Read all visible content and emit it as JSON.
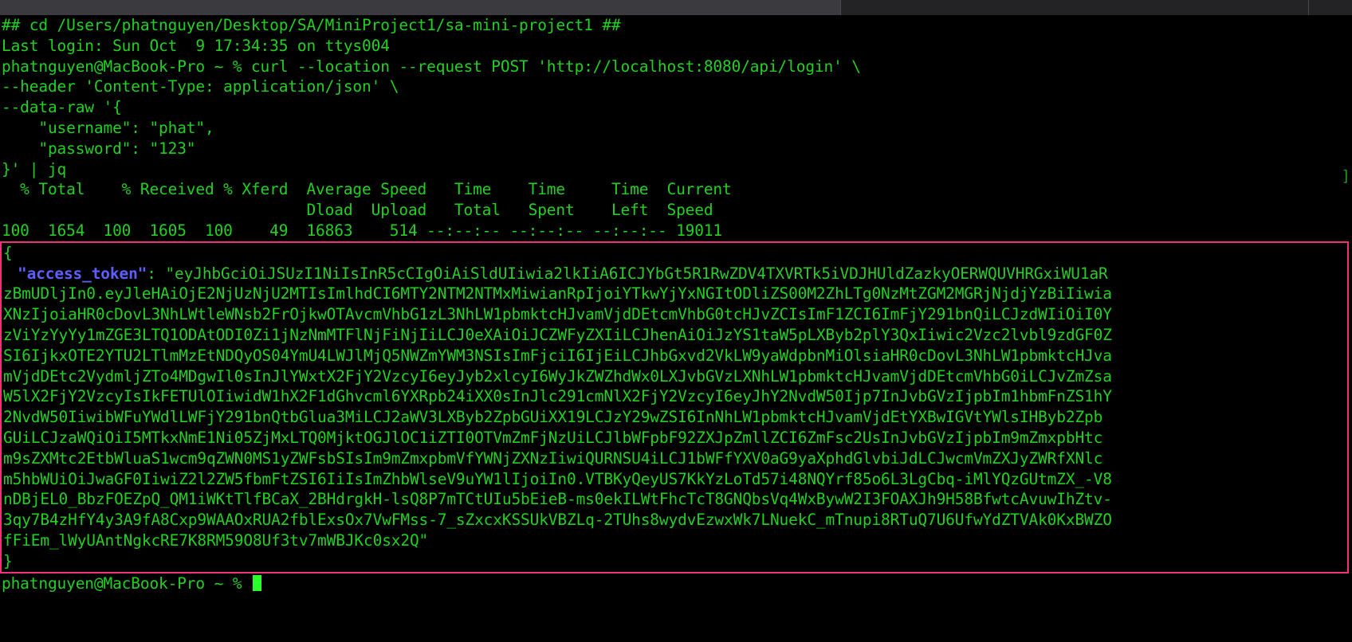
{
  "window": {
    "chrome_visible": true,
    "background_color": "#000000",
    "foreground_color": "#22d022",
    "highlight_border_color": "#f0317a",
    "key_color": "#5f5fff",
    "cursor_color": "#2bff2b"
  },
  "terminal": {
    "lines": [
      "## cd /Users/phatnguyen/Desktop/SA/MiniProject1/sa-mini-project1 ##",
      "Last login: Sun Oct  9 17:34:35 on ttys004",
      "phatnguyen@MacBook-Pro ~ % curl --location --request POST 'http://localhost:8080/api/login' \\",
      "--header 'Content-Type: application/json' \\",
      "--data-raw '{",
      "    \"username\": \"phat\",",
      "    \"password\": \"123\"",
      "}' | jq",
      "  % Total    % Received % Xferd  Average Speed   Time    Time     Time  Current",
      "                                 Dload  Upload   Total   Spent    Left  Speed",
      "100  1654  100  1605  100    49  16863    514 --:--:-- --:--:-- --:--:-- 19011"
    ],
    "right_edge_artifact": "]"
  },
  "json_output": {
    "open_brace": "{",
    "key_label": "\"access_token\"",
    "key_separator": ": ",
    "token_lines": [
      "\"eyJhbGciOiJSUzI1NiIsInR5cCIgOiAiSldUIiwia2lkIiA6ICJYbGt5R1RwZDV4TXVRTk5iVDJHUldZazkyOERWQUVHRGxiWU1aR",
      "zBmUDljIn0.eyJleHAiOjE2NjUzNjU2MTIsImlhdCI6MTY2NTM2NTMxMiwianRpIjoiYTkwYjYxNGItODliZS00M2ZhLTg0NzMtZGM2MGRjNjdjYzBiIiwia",
      "XNzIjoiaHR0cDovL3NhLWtleWNsb2FrOjkwOTAvcmVhbG1zL3NhLW1pbmktcHJvamVjdDEtcmVhbG0tcHJvZCIsImF1ZCI6ImFjY291bnQiLCJzdWIiOiI0Y",
      "zViYzYyYy1mZGE3LTQ1ODAtODI0Zi1jNzNmMTFlNjFiNjIiLCJ0eXAiOiJCZWFyZXIiLCJhenAiOiJzYS1taW5pLXByb2plY3QxIiwic2Vzc2lvbl9zdGF0Z",
      "SI6IjkxOTE2YTU2LTlmMzEtNDQyOS04YmU4LWJlMjQ5NWZmYWM3NSIsImFjciI6IjEiLCJhbGxvd2VkLW9yaWdpbnMiOlsiaHR0cDovL3NhLW1pbmktcHJva",
      "mVjdDEtc2VydmljZTo4MDgwIl0sInJlYWxtX2FjY2VzcyI6eyJyb2xlcyI6WyJkZWZhdWx0LXJvbGVzLXNhLW1pbmktcHJvamVjdDEtcmVhbG0iLCJvZmZsa",
      "W5lX2FjY2VzcyIsIkFETUlOIiwidW1hX2F1dGhvcml6YXRpb24iXX0sInJlc291cmNlX2FjY2VzcyI6eyJhY2NvdW50Ijp7InJvbGVzIjpbIm1hbmFnZS1hY",
      "2NvdW50IiwibWFuYWdlLWFjY291bnQtbGlua3MiLCJ2aWV3LXByb2ZpbGUiXX19LCJzY29wZSI6InNhLW1pbmktcHJvamVjdEtYXBwIGVtYWlsIHByb2Zpb",
      "GUiLCJzaWQiOiI5MTkxNmE1Ni05ZjMxLTQ0MjktOGJlOC1iZTI0OTVmZmFjNzUiLCJlbWFpbF92ZXJpZmllZCI6ZmFsc2UsInJvbGVzIjpbIm9mZmxpbHtc",
      "m9sZXMtc2EtbWluaS1wcm9qZWN0MS1yZWFsbSIsIm9mZmxpbmVfYWNjZXNzIiwiQURNSU4iLCJ1bWFfYXV0aG9yaXphdGlvbiJdLCJwcmVmZXJyZWRfXNlc",
      "m5hbWUiOiJwaGF0IiwiZ2l2ZW5fbmFtZSI6IiIsImZhbWlseV9uYW1lIjoiIn0.VTBKyQeyUS7KkYzLoTd57i48NQYrf85o6L3LgCbq-iMlYQzGUtmZX_-V8",
      "nDBjEL0_BbzFOEZpQ_QM1iWKtTlfBCaX_2BHdrgkH-lsQ8P7mTCtUIu5bEieB-ms0ekILWtFhcTcT8GNQbsVq4WxBywW2I3FOAXJh9H58BfwtcAvuwIhZtv-",
      "3qy7B4zHfY4y3A9fA8Cxp9WAAOxRUA2fblExsOx7VwFMss-7_sZxcxKSSUkVBZLq-2TUhs8wydvEzwxWk7LNuekC_mTnupi8RTuQ7U6UfwYdZTVAk0KxBWZO",
      "fFiEm_lWyUAntNgkcRE7K8RM59O8Uf3tv7mWBJKc0sx2Q\""
    ],
    "close_brace": "}"
  },
  "prompt": {
    "text": "phatnguyen@MacBook-Pro ~ % ",
    "cursor": "block"
  }
}
